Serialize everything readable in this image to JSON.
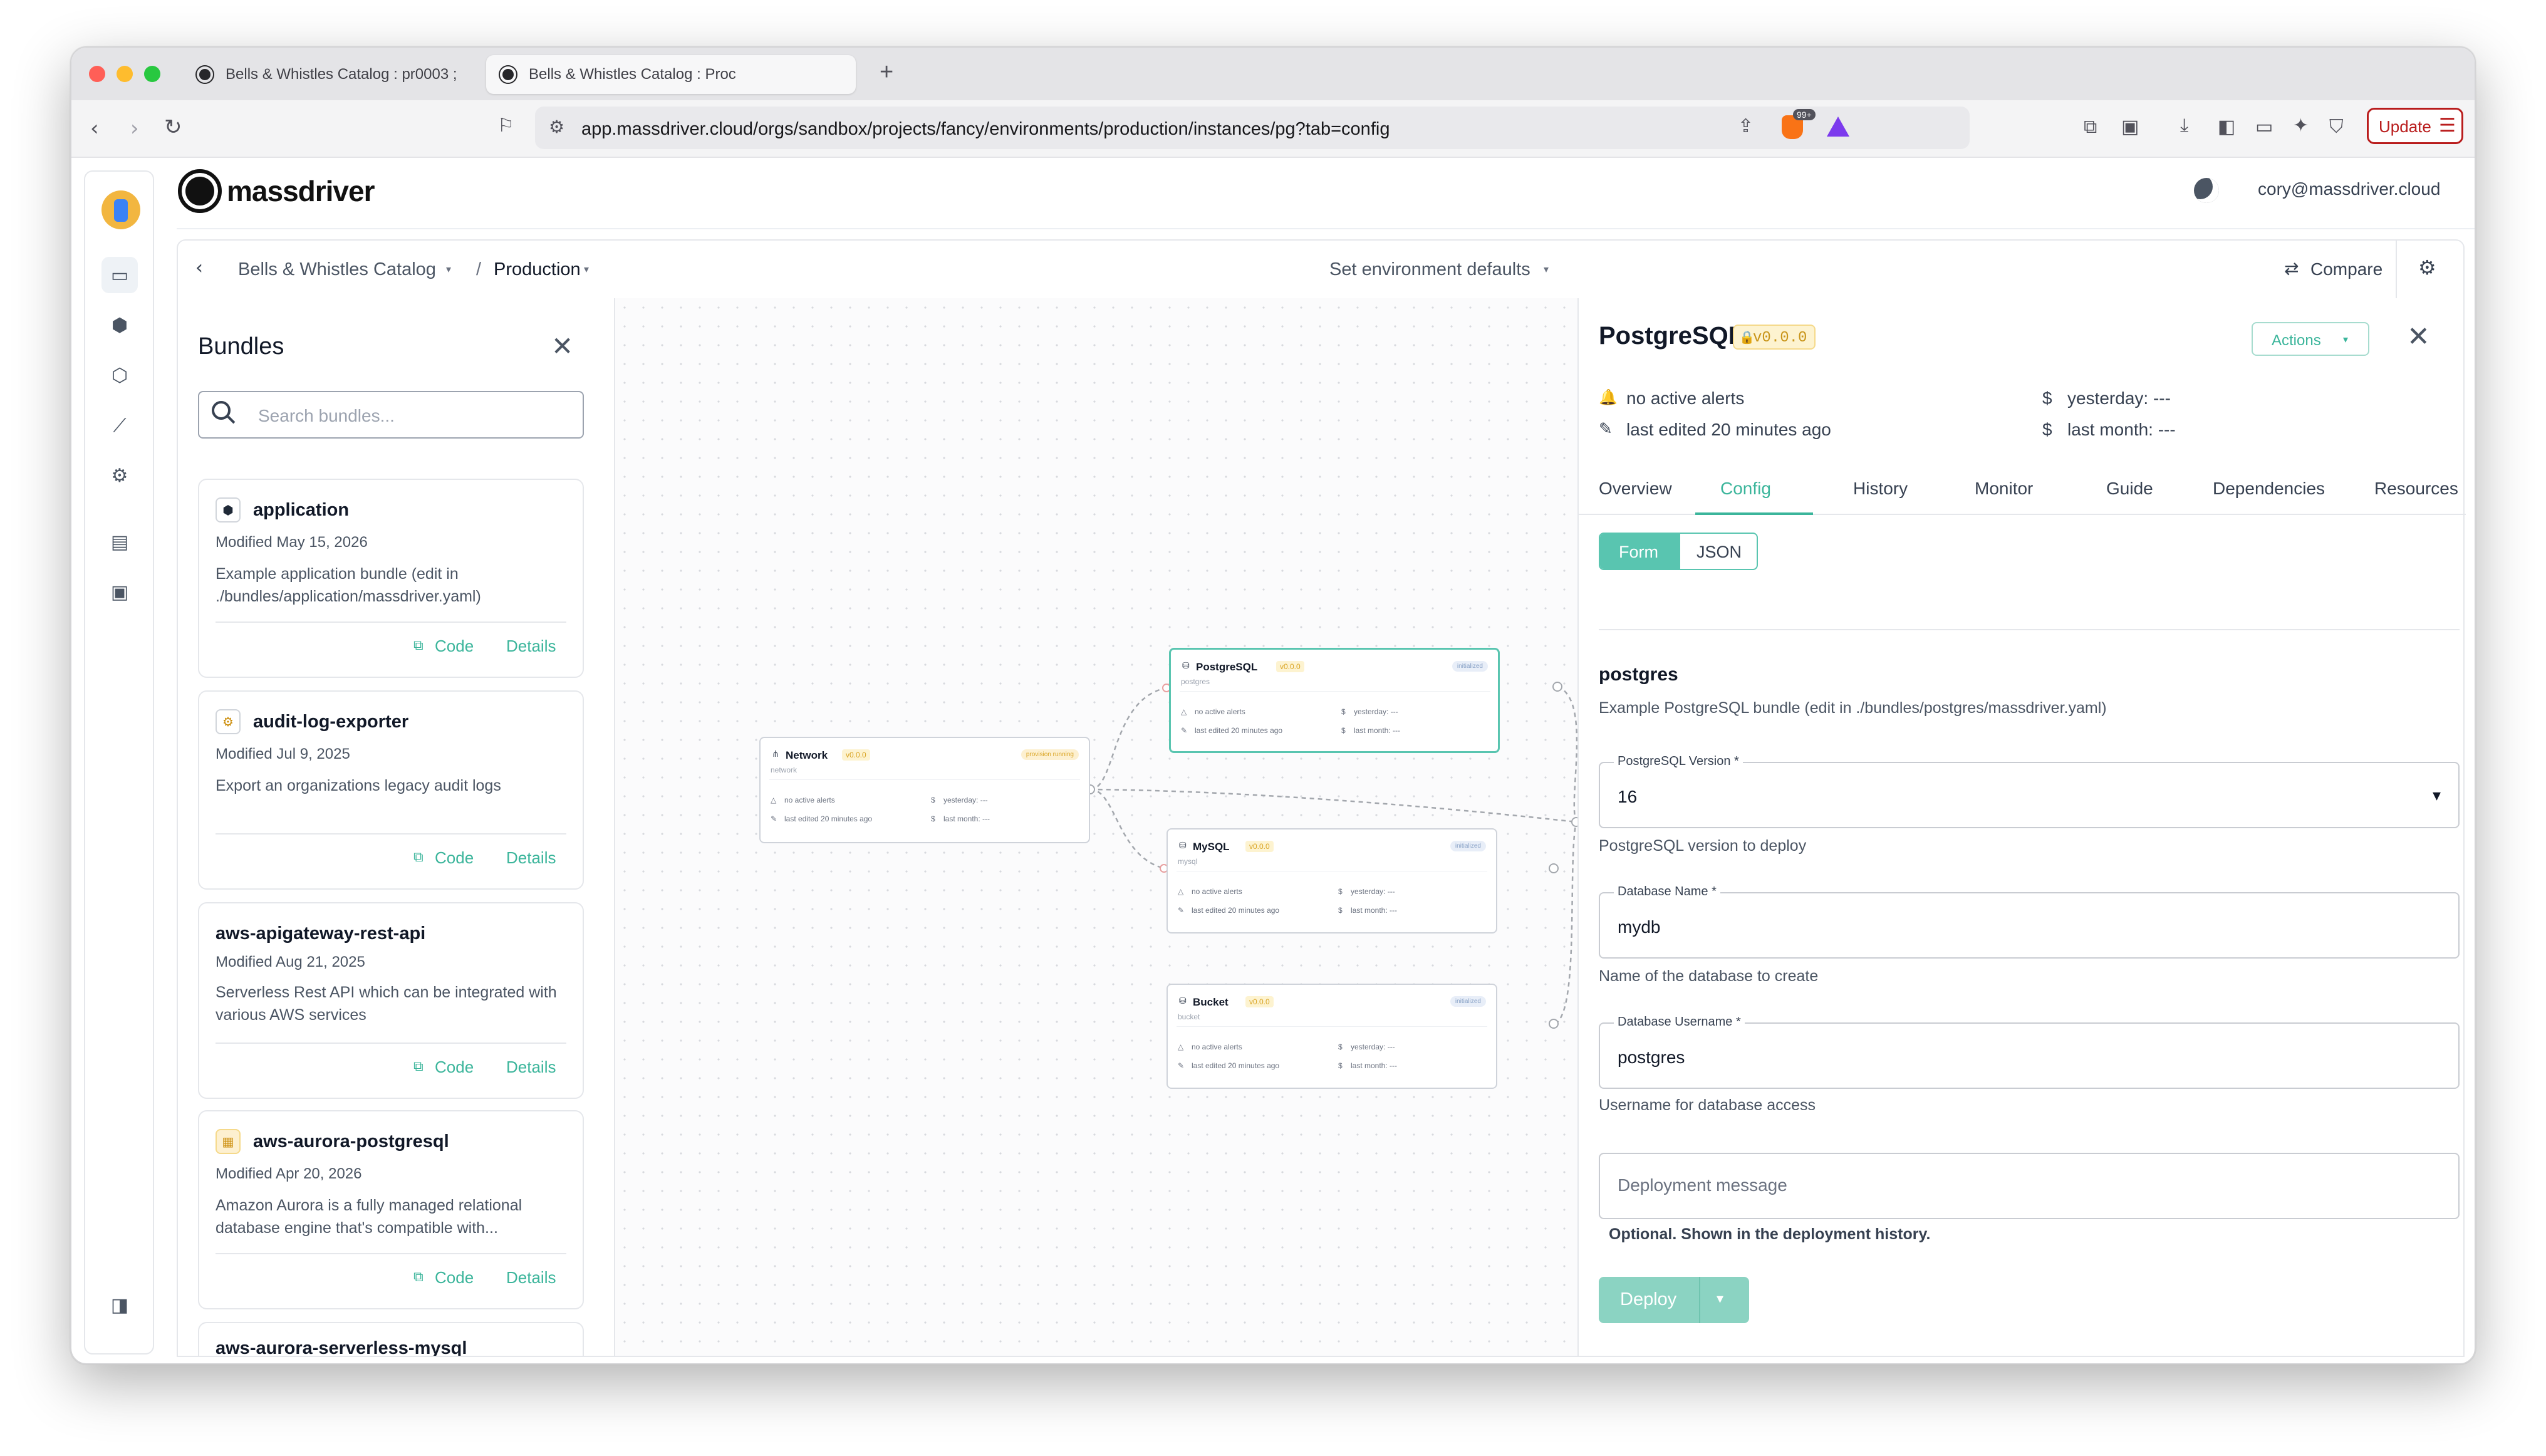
{
  "browser": {
    "tabs": [
      {
        "title": "Bells & Whistles Catalog : pr0003 ;"
      },
      {
        "title": "Bells & Whistles Catalog : Proc"
      }
    ],
    "new_tab": "+",
    "url": "app.massdriver.cloud/orgs/sandbox/projects/fancy/environments/production/instances/pg?tab=config",
    "badge_count": "99+",
    "update_label": "Update"
  },
  "app": {
    "brand": "massdriver",
    "user_email": "cory@massdriver.cloud"
  },
  "breadcrumb": {
    "project": "Bells & Whistles Catalog",
    "separator": "/",
    "environment": "Production",
    "env_defaults": "Set environment defaults",
    "compare": "Compare"
  },
  "bundles_panel": {
    "title": "Bundles",
    "search_placeholder": "Search bundles...",
    "code_label": "Code",
    "details_label": "Details",
    "items": [
      {
        "name": "application",
        "modified": "Modified May 15, 2026",
        "description": "Example application bundle (edit in ./bundles/application/massdriver.yaml)",
        "icon": "cube-icon"
      },
      {
        "name": "audit-log-exporter",
        "modified": "Modified Jul 9, 2025",
        "description": "Export an organizations legacy audit logs",
        "icon": "gear-icon"
      },
      {
        "name": "aws-apigateway-rest-api",
        "modified": "Modified Aug 21, 2025",
        "description": "Serverless Rest API which can be integrated with various AWS services",
        "icon": ""
      },
      {
        "name": "aws-aurora-postgresql",
        "modified": "Modified Apr 20, 2026",
        "description": "Amazon Aurora is a fully managed relational database engine that's compatible with...",
        "icon": "aurora-icon"
      },
      {
        "name": "aws-aurora-serverless-mysql",
        "modified": "",
        "description": "",
        "icon": ""
      }
    ]
  },
  "canvas": {
    "nodes": [
      {
        "title": "Network",
        "version": "v0.0.0",
        "slug": "network",
        "status": "provision running",
        "alerts": "no active alerts",
        "edited": "last edited 20 minutes ago",
        "yesterday": "yesterday: ---",
        "last_month": "last month: ---"
      },
      {
        "title": "PostgreSQL",
        "version": "v0.0.0",
        "slug": "postgres",
        "status": "initialized",
        "alerts": "no active alerts",
        "edited": "last edited 20 minutes ago",
        "yesterday": "yesterday: ---",
        "last_month": "last month: ---"
      },
      {
        "title": "MySQL",
        "version": "v0.0.0",
        "slug": "mysql",
        "status": "initialized",
        "alerts": "no active alerts",
        "edited": "last edited 20 minutes ago",
        "yesterday": "yesterday: ---",
        "last_month": "last month: ---"
      },
      {
        "title": "Bucket",
        "version": "v0.0.0",
        "slug": "bucket",
        "status": "initialized",
        "alerts": "no active alerts",
        "edited": "last edited 20 minutes ago",
        "yesterday": "yesterday: ---",
        "last_month": "last month: ---"
      }
    ]
  },
  "detail": {
    "title": "PostgreSQL",
    "version": "v0.0.0",
    "actions_label": "Actions",
    "alerts": "no active alerts",
    "edited": "last edited 20 minutes ago",
    "cost_yesterday": "yesterday: ---",
    "cost_last_month": "last month: ---",
    "tabs": [
      "Overview",
      "Config",
      "History",
      "Monitor",
      "Guide",
      "Dependencies",
      "Resources"
    ],
    "active_tab": "Config",
    "mode": {
      "form": "Form",
      "json": "JSON"
    },
    "section_title": "postgres",
    "section_desc": "Example PostgreSQL bundle (edit in ./bundles/postgres/massdriver.yaml)",
    "fields": [
      {
        "label": "PostgreSQL Version *",
        "value": "16",
        "help": "PostgreSQL version to deploy"
      },
      {
        "label": "Database Name *",
        "value": "mydb",
        "help": "Name of the database to create"
      },
      {
        "label": "Database Username *",
        "value": "postgres",
        "help": "Username for database access"
      }
    ],
    "deploy_message_placeholder": "Deployment message",
    "deploy_message_help": "Optional. Shown in the deployment history.",
    "deploy_label": "Deploy"
  },
  "colors": {
    "accent": "#59c5b0",
    "accent_text": "#3bb59b",
    "version_badge": "#d9a321",
    "update_border": "#b91c1c"
  }
}
